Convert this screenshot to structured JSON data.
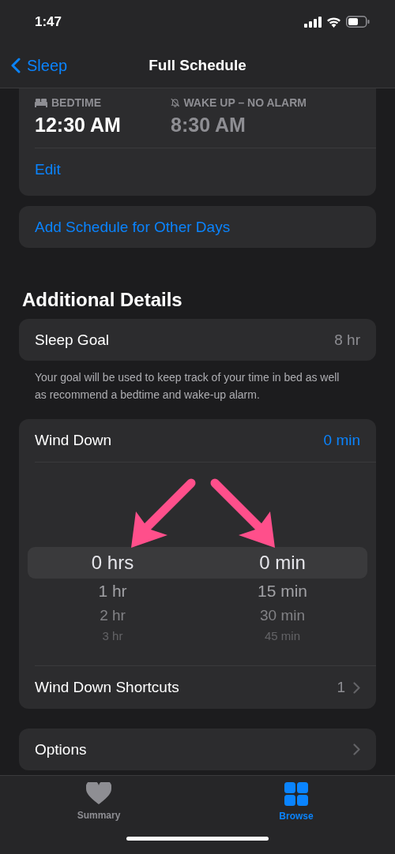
{
  "status_bar": {
    "time": "1:47"
  },
  "nav": {
    "back": "Sleep",
    "title": "Full Schedule"
  },
  "schedule": {
    "bedtime_label": "BEDTIME",
    "bedtime": "12:30 AM",
    "wake_label": "WAKE UP – NO ALARM",
    "wake": "8:30 AM",
    "edit": "Edit"
  },
  "add_schedule": "Add Schedule for Other Days",
  "section_title": "Additional Details",
  "sleep_goal": {
    "label": "Sleep Goal",
    "value": "8 hr"
  },
  "footnote": "Your goal will be used to keep track of your time in bed as well as recommend a bedtime and wake-up alarm.",
  "wind_down": {
    "label": "Wind Down",
    "value": "0 min",
    "picker": [
      {
        "items": [
          {
            "text": "0 hrs",
            "selected": true
          },
          {
            "text": "1 hr",
            "selected": false
          },
          {
            "text": "2 hr",
            "selected": false
          },
          {
            "text": "3 hr",
            "selected": false
          }
        ]
      },
      {
        "items": [
          {
            "text": "0 min",
            "selected": true
          },
          {
            "text": "15 min",
            "selected": false
          },
          {
            "text": "30 min",
            "selected": false
          },
          {
            "text": "45 min",
            "selected": false
          }
        ]
      }
    ],
    "shortcuts": {
      "label": "Wind Down Shortcuts",
      "value": "1"
    }
  },
  "options": "Options",
  "tabs": [
    {
      "label": "Summary",
      "kind": "heart",
      "selected": false
    },
    {
      "label": "Browse",
      "kind": "grid",
      "selected": true
    }
  ]
}
